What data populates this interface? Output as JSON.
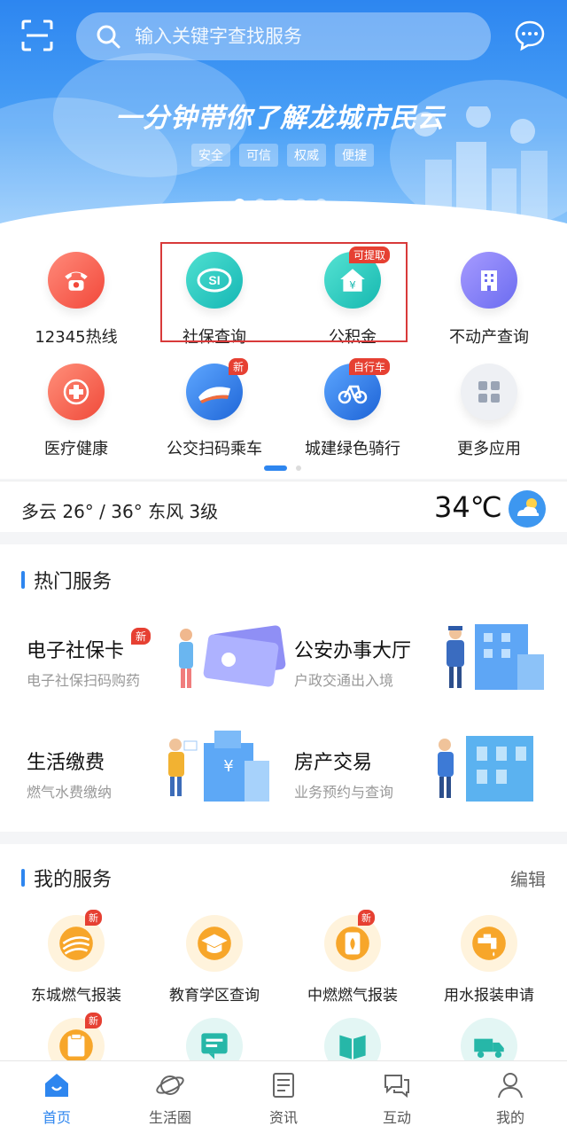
{
  "search": {
    "placeholder": "输入关键字查找服务"
  },
  "banner": {
    "title": "一分钟带你了解龙城市民云",
    "tags": [
      "安全",
      "可信",
      "权威",
      "便捷"
    ]
  },
  "apps": [
    {
      "label": "12345热线",
      "tag": ""
    },
    {
      "label": "社保查询",
      "tag": ""
    },
    {
      "label": "公积金",
      "tag": "可提取"
    },
    {
      "label": "不动产查询",
      "tag": ""
    },
    {
      "label": "医疗健康",
      "tag": ""
    },
    {
      "label": "公交扫码乘车",
      "tag": "新"
    },
    {
      "label": "城建绿色骑行",
      "tag": "自行车"
    },
    {
      "label": "更多应用",
      "tag": ""
    }
  ],
  "weather": {
    "desc": "多云  26° / 36°  东风 3级",
    "temp": "34℃"
  },
  "hot": {
    "title": "热门服务",
    "cards": [
      {
        "title": "电子社保卡",
        "sub": "电子社保扫码购药",
        "tag": "新"
      },
      {
        "title": "公安办事大厅",
        "sub": "户政交通出入境",
        "tag": ""
      },
      {
        "title": "生活缴费",
        "sub": "燃气水费缴纳",
        "tag": ""
      },
      {
        "title": "房产交易",
        "sub": "业务预约与查询",
        "tag": ""
      }
    ]
  },
  "my": {
    "title": "我的服务",
    "edit": "编辑",
    "items": [
      {
        "label": "东城燃气报装",
        "tag": "新"
      },
      {
        "label": "教育学区查询",
        "tag": ""
      },
      {
        "label": "中燃燃气报装",
        "tag": "新"
      },
      {
        "label": "用水报装申请",
        "tag": ""
      }
    ],
    "row2_tag": "新"
  },
  "tabs": [
    {
      "label": "首页"
    },
    {
      "label": "生活圈"
    },
    {
      "label": "资讯"
    },
    {
      "label": "互动"
    },
    {
      "label": "我的"
    }
  ],
  "colors": {
    "accent": "#2e86ef",
    "badge": "#e64032",
    "highlight": "#d83a3a"
  }
}
